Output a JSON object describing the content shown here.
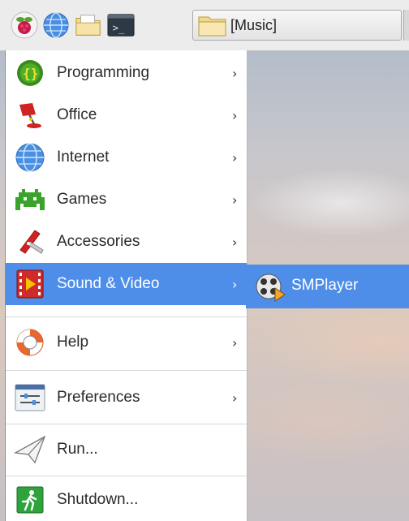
{
  "taskbar": {
    "launchers": [
      {
        "icon": "raspberry-menu-icon"
      },
      {
        "icon": "web-browser-globe-icon"
      },
      {
        "icon": "file-manager-icon"
      },
      {
        "icon": "terminal-icon"
      }
    ],
    "task": {
      "label": "[Music]",
      "icon": "folder-icon"
    }
  },
  "menu": {
    "items": [
      {
        "label": "Programming",
        "icon": "programming-icon",
        "submenu": true
      },
      {
        "label": "Office",
        "icon": "office-lamp-icon",
        "submenu": true
      },
      {
        "label": "Internet",
        "icon": "internet-globe-icon",
        "submenu": true
      },
      {
        "label": "Games",
        "icon": "games-invader-icon",
        "submenu": true
      },
      {
        "label": "Accessories",
        "icon": "accessories-knife-icon",
        "submenu": true
      },
      {
        "label": "Sound & Video",
        "icon": "sound-video-icon",
        "submenu": true,
        "active": true
      },
      {
        "label": "Help",
        "icon": "help-lifebuoy-icon",
        "submenu": true
      },
      {
        "label": "Preferences",
        "icon": "preferences-icon",
        "submenu": true
      },
      {
        "label": "Run...",
        "icon": "run-paperplane-icon",
        "submenu": false
      },
      {
        "label": "Shutdown...",
        "icon": "shutdown-exit-icon",
        "submenu": false
      }
    ],
    "arrow": "›"
  },
  "submenu": {
    "items": [
      {
        "label": "SMPlayer",
        "icon": "smplayer-icon"
      }
    ]
  },
  "colors": {
    "highlight": "#4f8ee8",
    "menu_bg": "#ffffff",
    "panel_bg": "#ececec"
  }
}
